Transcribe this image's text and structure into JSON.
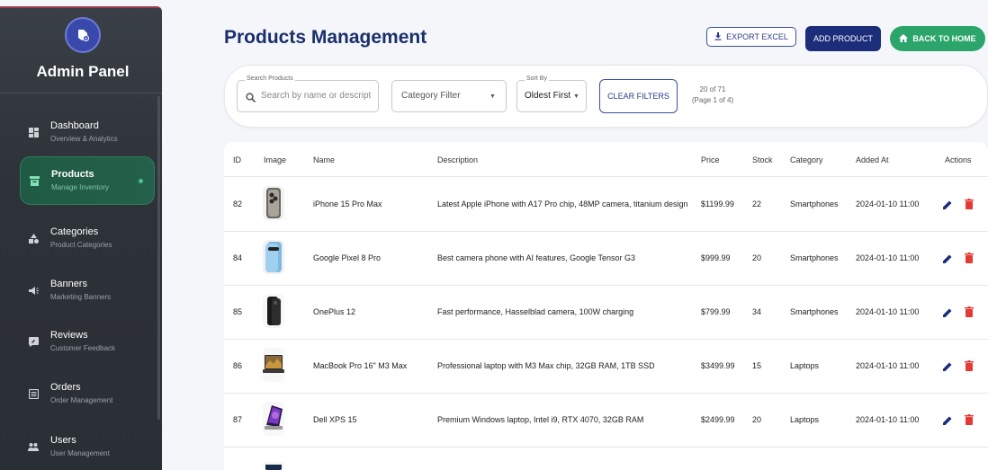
{
  "sidebar": {
    "title": "Admin Panel",
    "items": [
      {
        "label": "Dashboard",
        "sub": "Overview & Analytics",
        "icon": "dashboard-icon"
      },
      {
        "label": "Products",
        "sub": "Manage Inventory",
        "icon": "inventory-icon",
        "active": true
      },
      {
        "label": "Categories",
        "sub": "Product Categories",
        "icon": "category-icon"
      },
      {
        "label": "Banners",
        "sub": "Marketing Banners",
        "icon": "megaphone-icon"
      },
      {
        "label": "Reviews",
        "sub": "Customer Feedback",
        "icon": "review-icon"
      },
      {
        "label": "Orders",
        "sub": "Order Management",
        "icon": "receipt-icon"
      },
      {
        "label": "Users",
        "sub": "User Management",
        "icon": "people-icon"
      }
    ]
  },
  "header": {
    "title": "Products Management",
    "export_label": "EXPORT EXCEL",
    "add_label": "ADD PRODUCT",
    "home_label": "BACK TO HOME"
  },
  "filters": {
    "search_legend": "Search Products",
    "search_placeholder": "Search by name or descript",
    "category_placeholder": "Category Filter",
    "sort_legend": "Sort By",
    "sort_value": "Oldest First",
    "clear_label": "CLEAR FILTERS",
    "count_line1": "20 of 71",
    "count_line2": "(Page 1 of 4)"
  },
  "table": {
    "headers": {
      "id": "ID",
      "image": "Image",
      "name": "Name",
      "description": "Description",
      "price": "Price",
      "stock": "Stock",
      "category": "Category",
      "added": "Added At",
      "actions": "Actions"
    },
    "rows": [
      {
        "id": "82",
        "name": "iPhone 15 Pro Max",
        "description": "Latest Apple iPhone with A17 Pro chip, 48MP camera, titanium design",
        "price": "$1199.99",
        "stock": "22",
        "category": "Smartphones",
        "added": "2024-01-10 11:00"
      },
      {
        "id": "84",
        "name": "Google Pixel 8 Pro",
        "description": "Best camera phone with AI features, Google Tensor G3",
        "price": "$999.99",
        "stock": "20",
        "category": "Smartphones",
        "added": "2024-01-10 11:00"
      },
      {
        "id": "85",
        "name": "OnePlus 12",
        "description": "Fast performance, Hasselblad camera, 100W charging",
        "price": "$799.99",
        "stock": "34",
        "category": "Smartphones",
        "added": "2024-01-10 11:00"
      },
      {
        "id": "86",
        "name": "MacBook Pro 16\" M3 Max",
        "description": "Professional laptop with M3 Max chip, 32GB RAM, 1TB SSD",
        "price": "$3499.99",
        "stock": "15",
        "category": "Laptops",
        "added": "2024-01-10 11:00"
      },
      {
        "id": "87",
        "name": "Dell XPS 15",
        "description": "Premium Windows laptop, Intel i9, RTX 4070, 32GB RAM",
        "price": "$2499.99",
        "stock": "20",
        "category": "Laptops",
        "added": "2024-01-10 11:00"
      }
    ]
  },
  "colors": {
    "primary": "#1c2d7a",
    "success": "#2ba56a",
    "danger": "#e53935",
    "title": "#1a2f6b"
  }
}
